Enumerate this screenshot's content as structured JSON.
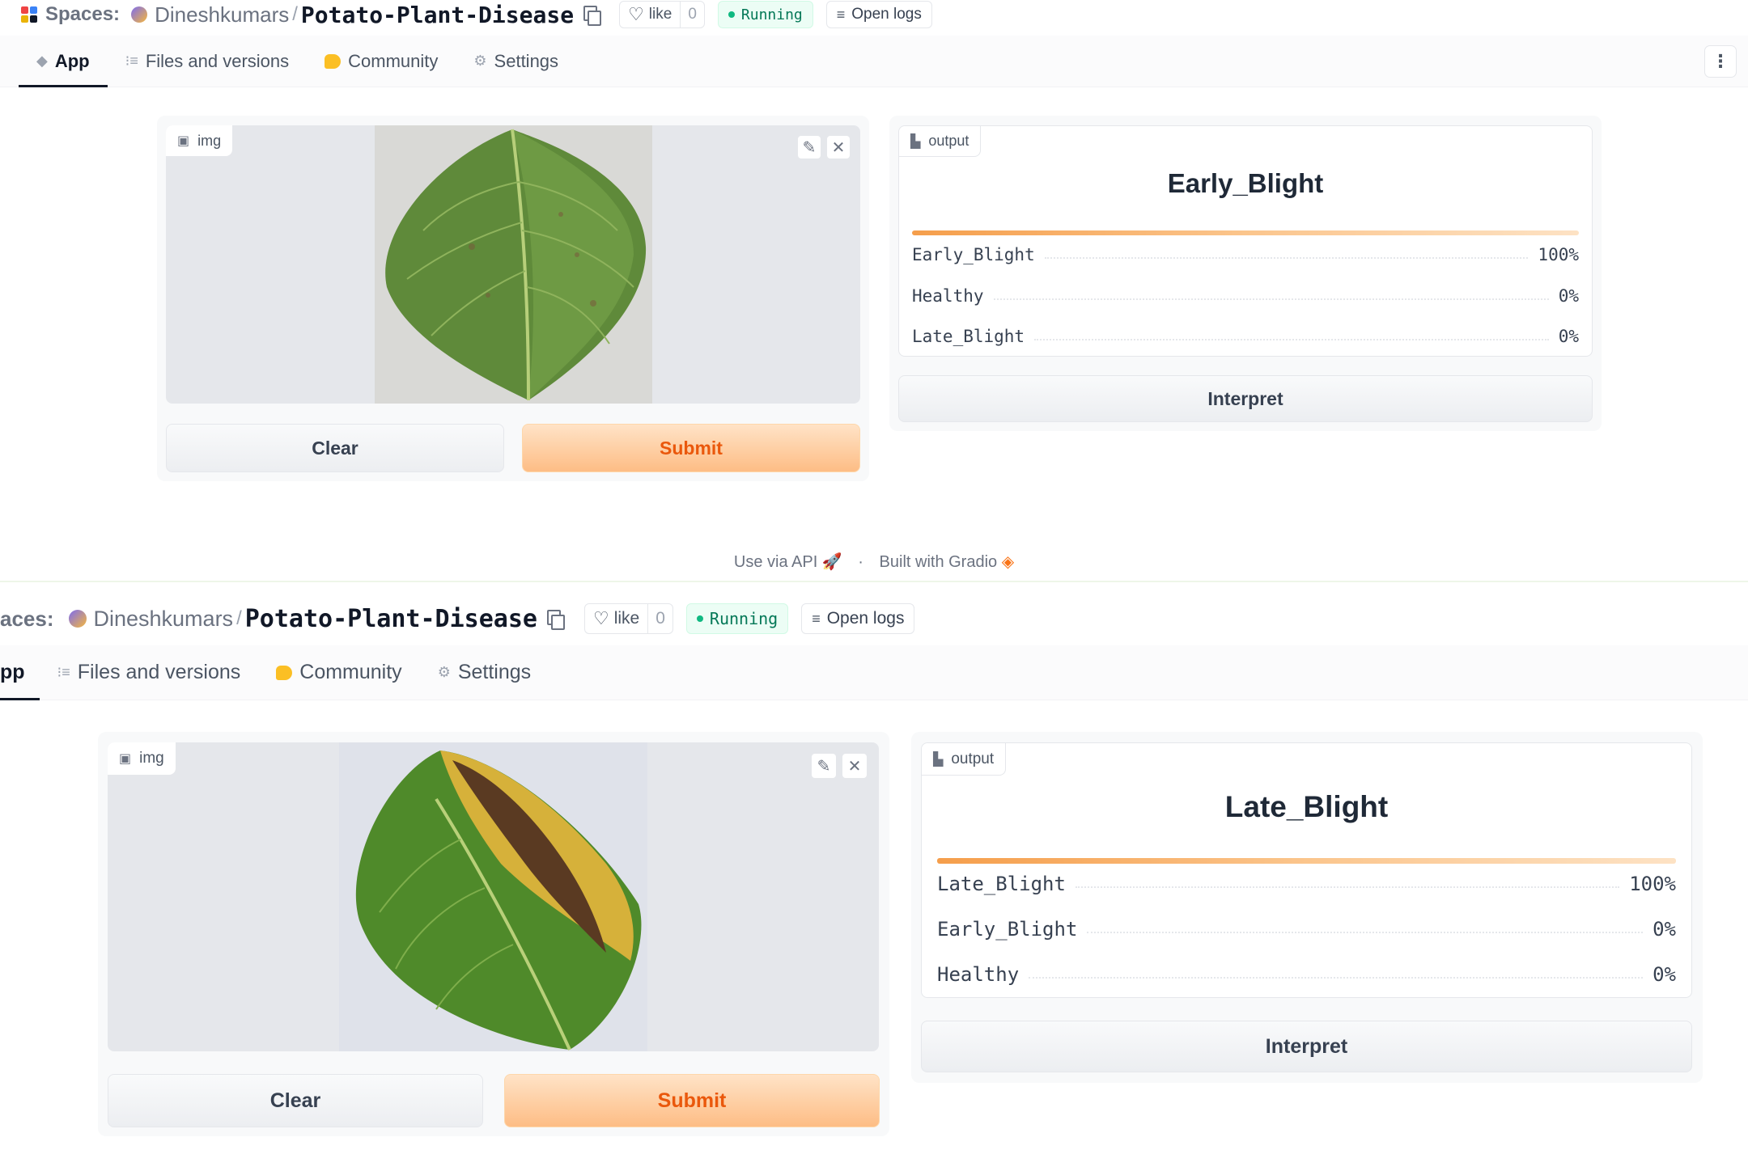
{
  "header": {
    "spaces_label": "Spaces:",
    "owner": "Dineshkumars",
    "separator": "/",
    "repo": "Potato-Plant-Disease",
    "like_label": "like",
    "like_count": "0",
    "status": "Running",
    "open_logs": "Open logs"
  },
  "header_cropped": {
    "spaces_label": "aces:"
  },
  "tabs": [
    {
      "label": "App",
      "icon": "cube-icon",
      "active": true
    },
    {
      "label": "Files and versions",
      "icon": "files-icon",
      "active": false
    },
    {
      "label": "Community",
      "icon": "community-icon",
      "active": false
    },
    {
      "label": "Settings",
      "icon": "gear-icon",
      "active": false
    }
  ],
  "tabs_cropped": {
    "app_label": "pp"
  },
  "app": {
    "input_label": "img",
    "output_label": "output",
    "clear_label": "Clear",
    "submit_label": "Submit",
    "interpret_label": "Interpret"
  },
  "prediction1": {
    "top_label": "Early_Blight",
    "confidences": [
      {
        "label": "Early_Blight",
        "value": "100%"
      },
      {
        "label": "Healthy",
        "value": "0%"
      },
      {
        "label": "Late_Blight",
        "value": "0%"
      }
    ]
  },
  "prediction2": {
    "top_label": "Late_Blight",
    "confidences": [
      {
        "label": "Late_Blight",
        "value": "100%"
      },
      {
        "label": "Early_Blight",
        "value": "0%"
      },
      {
        "label": "Healthy",
        "value": "0%"
      }
    ]
  },
  "footer": {
    "api_label": "Use via API",
    "separator": "·",
    "built_label": "Built with Gradio"
  },
  "colors": {
    "accent_orange": "#ea580c",
    "running_green": "#10b981"
  }
}
